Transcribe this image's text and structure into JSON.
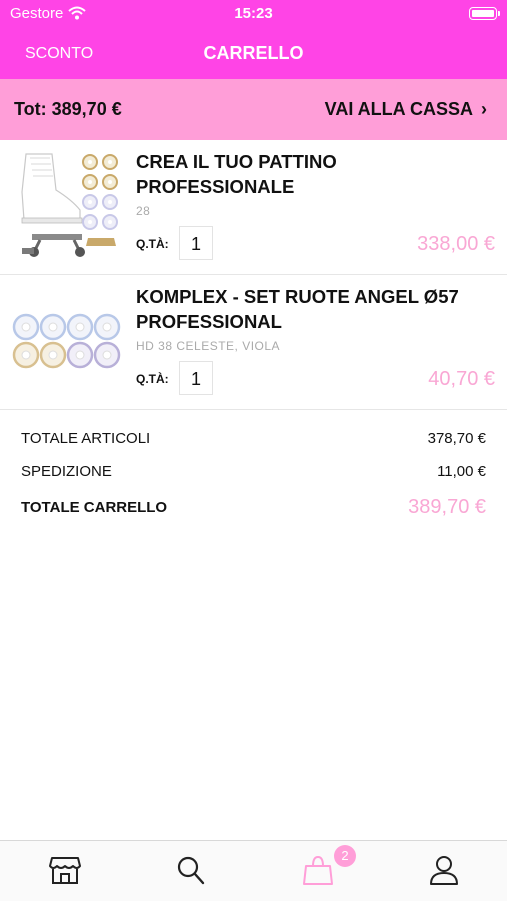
{
  "status_bar": {
    "carrier": "Gestore",
    "time": "15:23"
  },
  "nav": {
    "left_label": "SCONTO",
    "title": "CARRELLO"
  },
  "total_bar": {
    "total_label": "Tot: 389,70 €",
    "checkout_label": "VAI ALLA CASSA"
  },
  "items": [
    {
      "name": "CREA IL TUO PATTINO PROFESSIONALE",
      "variant": "28",
      "qty_label": "Q.TÀ:",
      "qty": "1",
      "price": "338,00 €"
    },
    {
      "name": "KOMPLEX - SET RUOTE ANGEL Ø57 PROFESSIONAL",
      "variant": "HD 38 CELESTE, VIOLA",
      "qty_label": "Q.TÀ:",
      "qty": "1",
      "price": "40,70 €"
    }
  ],
  "summary": {
    "articles_label": "TOTALE ARTICOLI",
    "articles_value": "378,70 €",
    "shipping_label": "SPEDIZIONE",
    "shipping_value": "11,00 €",
    "cart_total_label": "TOTALE CARRELLO",
    "cart_total_value": "389,70 €"
  },
  "tabbar": {
    "items": [
      "store-icon",
      "search-icon",
      "bag-icon",
      "user-icon"
    ],
    "cart_badge": "2"
  },
  "colors": {
    "header": "#ff44e6",
    "total_bar": "#ff9ed8",
    "price": "#f9a7d4"
  }
}
